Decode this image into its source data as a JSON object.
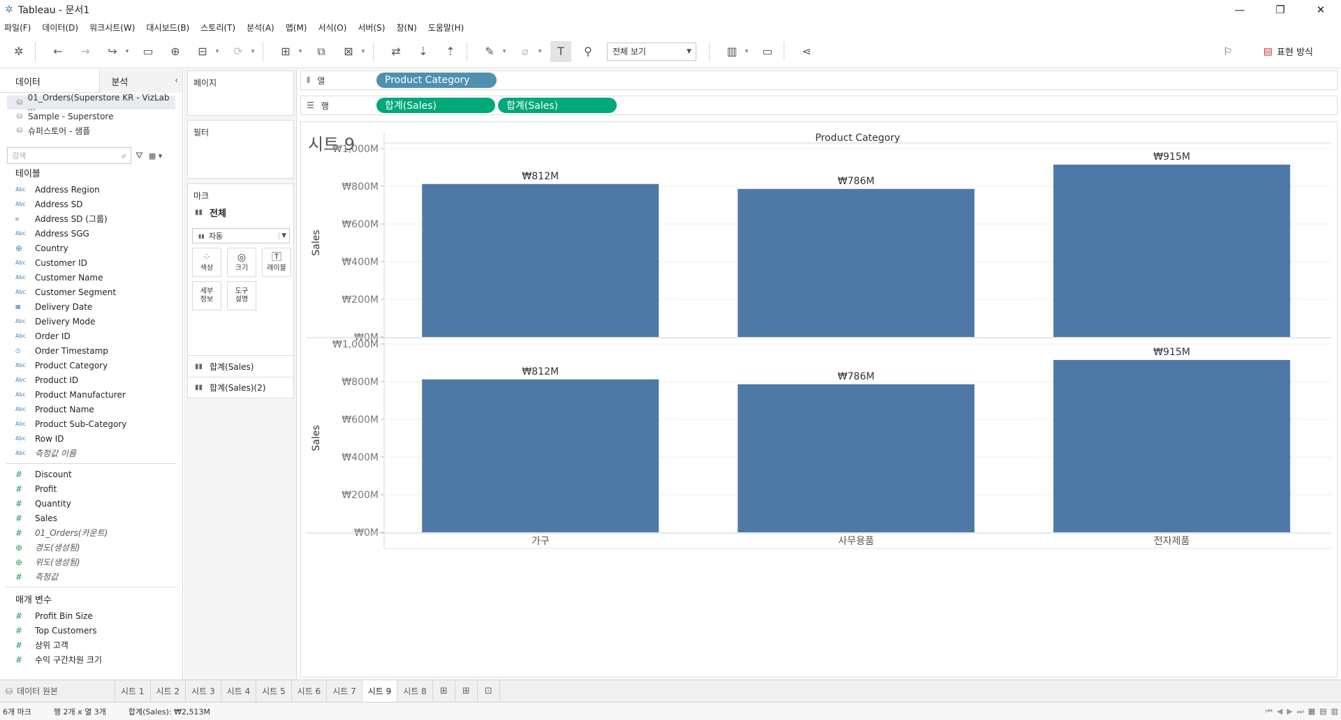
{
  "window": {
    "title": "Tableau - 문서1",
    "minimize": "—",
    "restore": "❐",
    "close": "✕"
  },
  "menu": [
    "파일(F)",
    "데이터(D)",
    "워크시트(W)",
    "대시보드(B)",
    "스토리(T)",
    "분석(A)",
    "맵(M)",
    "서식(O)",
    "서버(S)",
    "창(N)",
    "도움말(H)"
  ],
  "toolbar": {
    "view_select": "전체 보기",
    "show_me": "표현 방식"
  },
  "data_pane": {
    "tab_data": "데이터",
    "tab_analysis": "분석",
    "datasources": [
      "01_Orders(Superstore KR - VizLab ...",
      "Sample - Superstore",
      "슈퍼스토어 - 샘플"
    ],
    "search_placeholder": "검색",
    "tables_header": "테이블",
    "dimensions": [
      {
        "type": "Abc",
        "name": "Address Region"
      },
      {
        "type": "Abc",
        "name": "Address SD"
      },
      {
        "type": "clip",
        "name": "Address SD (그룹)"
      },
      {
        "type": "Abc",
        "name": "Address SGG"
      },
      {
        "type": "globe",
        "name": "Country"
      },
      {
        "type": "Abc",
        "name": "Customer ID"
      },
      {
        "type": "Abc",
        "name": "Customer Name"
      },
      {
        "type": "Abc",
        "name": "Customer Segment"
      },
      {
        "type": "date",
        "name": "Delivery Date"
      },
      {
        "type": "Abc",
        "name": "Delivery Mode"
      },
      {
        "type": "Abc",
        "name": "Order ID"
      },
      {
        "type": "datetime",
        "name": "Order Timestamp"
      },
      {
        "type": "Abc",
        "name": "Product Category"
      },
      {
        "type": "Abc",
        "name": "Product ID"
      },
      {
        "type": "Abc",
        "name": "Product Manufacturer"
      },
      {
        "type": "Abc",
        "name": "Product Name"
      },
      {
        "type": "Abc",
        "name": "Product Sub-Category"
      },
      {
        "type": "Abc",
        "name": "Row ID"
      },
      {
        "type": "Abc",
        "name": "측정값 이름",
        "italic": true
      }
    ],
    "measures": [
      {
        "type": "#",
        "name": "Discount"
      },
      {
        "type": "#",
        "name": "Profit"
      },
      {
        "type": "#",
        "name": "Quantity"
      },
      {
        "type": "#",
        "name": "Sales"
      },
      {
        "type": "#",
        "name": "01_Orders(카운트)",
        "italic": true
      },
      {
        "type": "globe",
        "name": "경도(생성됨)",
        "italic": true
      },
      {
        "type": "globe",
        "name": "위도(생성됨)",
        "italic": true
      },
      {
        "type": "#",
        "name": "측정값",
        "italic": true
      }
    ],
    "params_header": "매개 변수",
    "parameters": [
      {
        "type": "#",
        "name": "Profit Bin Size"
      },
      {
        "type": "#",
        "name": "Top Customers"
      },
      {
        "type": "#",
        "name": "상위 고객"
      },
      {
        "type": "#",
        "name": "수익 구간차원 크기"
      }
    ]
  },
  "shelves": {
    "pages": "페이지",
    "filters": "필터",
    "marks": "마크",
    "marks_all": "전체",
    "marks_type": "자동",
    "mark_buttons": [
      {
        "icon": "color-icon",
        "label": "색상"
      },
      {
        "icon": "size-icon",
        "label": "크기"
      },
      {
        "icon": "label-icon",
        "label": "레이블"
      },
      {
        "icon": "detail-icon",
        "label": "세부\n정보"
      },
      {
        "icon": "tooltip-icon",
        "label": "도구\n설명"
      }
    ],
    "marks_sheets": [
      "합계(Sales)",
      "합계(Sales)(2)"
    ],
    "columns_label": "열",
    "rows_label": "행",
    "columns_pills": [
      "Product Category"
    ],
    "rows_pills": [
      "합계(Sales)",
      "합계(Sales)"
    ]
  },
  "sheet": {
    "title": "시트 9",
    "header": "Product Category"
  },
  "chart_data": {
    "type": "bar",
    "title": "",
    "categories": [
      "가구",
      "사무용품",
      "전자제품"
    ],
    "xlabel": "",
    "ylabel": "Sales",
    "ylim": [
      0,
      1000
    ],
    "yticks": [
      "₩0M",
      "₩200M",
      "₩400M",
      "₩600M",
      "₩800M",
      "₩1,000M"
    ],
    "color": "#4e79a7",
    "panes": [
      {
        "series": [
          {
            "name": "합계(Sales)",
            "values": [
              812,
              786,
              915
            ]
          }
        ],
        "labels": [
          "₩812M",
          "₩786M",
          "₩915M"
        ]
      },
      {
        "series": [
          {
            "name": "합계(Sales)",
            "values": [
              812,
              786,
              915
            ]
          }
        ],
        "labels": [
          "₩812M",
          "₩786M",
          "₩915M"
        ]
      }
    ]
  },
  "tabs": {
    "datasource": "데이터 원본",
    "sheets": [
      "시트 1",
      "시트 2",
      "시트 3",
      "시트 4",
      "시트 5",
      "시트 6",
      "시트 7",
      "시트 9",
      "시트 8"
    ],
    "active": "시트 9"
  },
  "status": {
    "marks": "6개 마크",
    "dims": "행 2개 x 열 3개",
    "sum": "합계(Sales): ₩2,513M"
  }
}
